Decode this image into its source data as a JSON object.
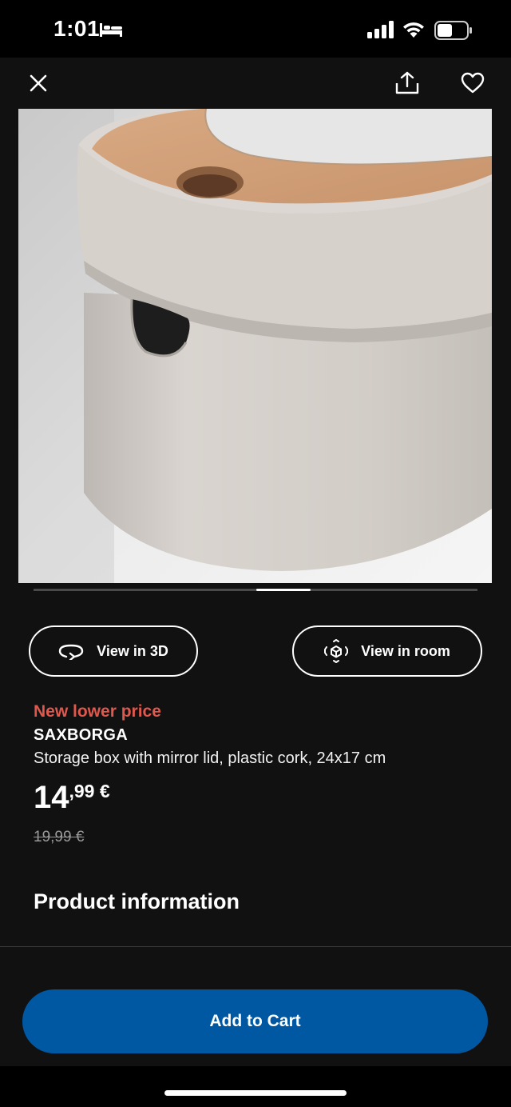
{
  "status_bar": {
    "time": "1:01",
    "icons": [
      "bed-icon",
      "signal-icon",
      "wifi-icon",
      "battery-icon"
    ]
  },
  "topbar": {
    "icons": [
      "close-icon",
      "share-icon",
      "heart-icon"
    ]
  },
  "gallery": {
    "image": "storage box with cork mirror lid photo",
    "carousel_position": "2nd of 5"
  },
  "actions": {
    "view_3d": {
      "label": "View in 3D",
      "icon": "rotate-3d-icon"
    },
    "view_room": {
      "label": "View in room",
      "icon": "ar-cube-icon"
    }
  },
  "product": {
    "promo_label": "New lower price",
    "name": "SAXBORGA",
    "description": "Storage box with mirror lid, plastic cork, 24x17 cm",
    "price_integer": "14",
    "price_decimal": ",99 €",
    "old_price": "19,99 €"
  },
  "sections": {
    "product_information": "Product information"
  },
  "cart": {
    "add_to_cart": "Add to Cart"
  },
  "colors": {
    "background": "#111111",
    "promo_red": "#e0584d",
    "cart_blue": "#0058a3"
  }
}
